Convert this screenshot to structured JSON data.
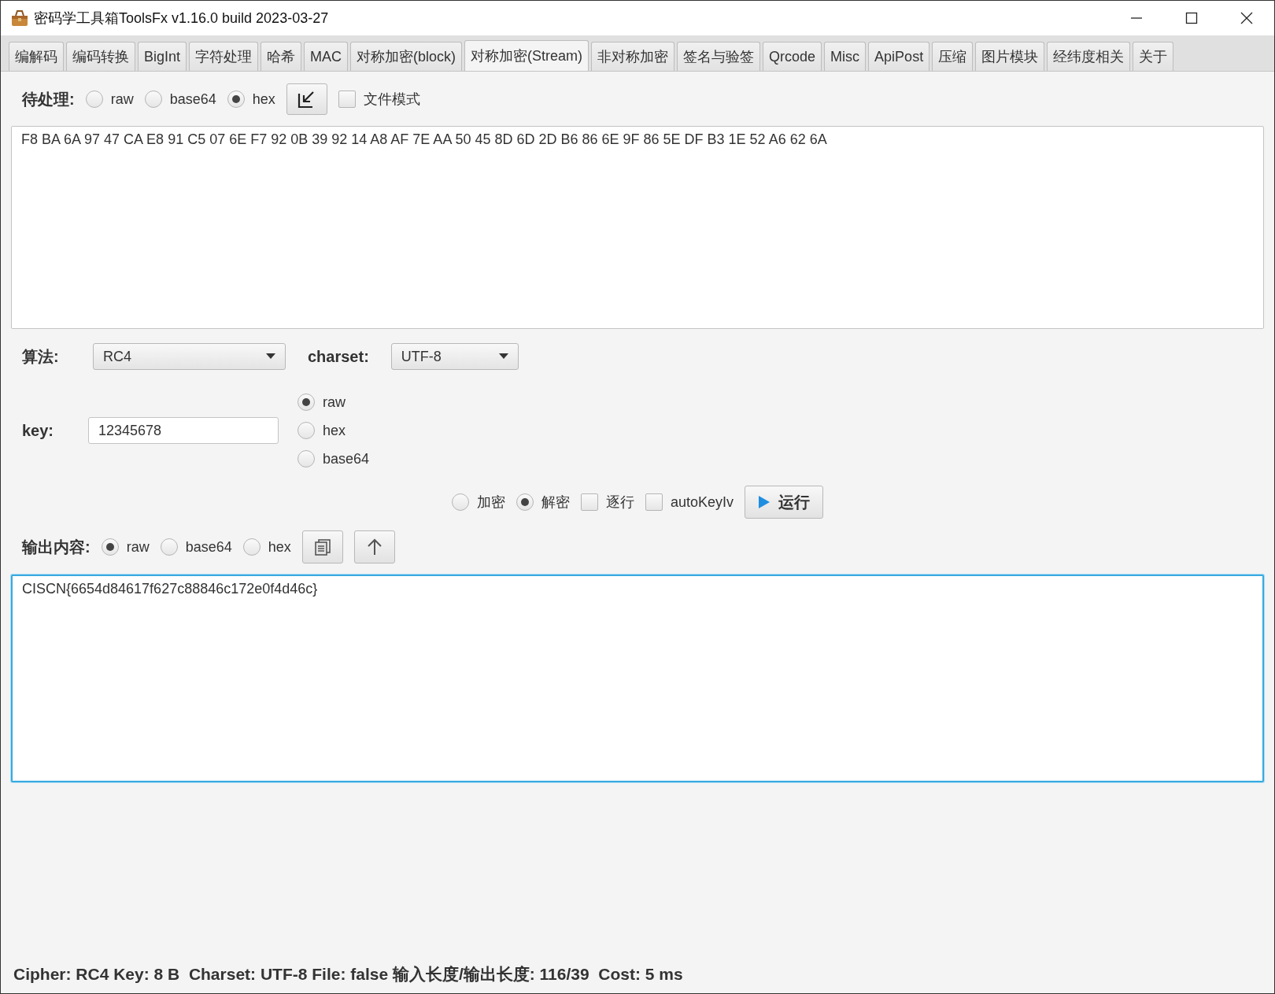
{
  "window": {
    "title": "密码学工具箱ToolsFx v1.16.0 build 2023-03-27"
  },
  "tabs": [
    {
      "label": "编解码",
      "selected": false
    },
    {
      "label": "编码转换",
      "selected": false
    },
    {
      "label": "BigInt",
      "selected": false
    },
    {
      "label": "字符处理",
      "selected": false
    },
    {
      "label": "哈希",
      "selected": false
    },
    {
      "label": "MAC",
      "selected": false
    },
    {
      "label": "对称加密(block)",
      "selected": false
    },
    {
      "label": "对称加密(Stream)",
      "selected": true
    },
    {
      "label": "非对称加密",
      "selected": false
    },
    {
      "label": "签名与验签",
      "selected": false
    },
    {
      "label": "Qrcode",
      "selected": false
    },
    {
      "label": "Misc",
      "selected": false
    },
    {
      "label": "ApiPost",
      "selected": false
    },
    {
      "label": "压缩",
      "selected": false
    },
    {
      "label": "图片模块",
      "selected": false
    },
    {
      "label": "经纬度相关",
      "selected": false
    },
    {
      "label": "关于",
      "selected": false
    }
  ],
  "input": {
    "label": "待处理:",
    "formats": [
      {
        "label": "raw",
        "selected": false
      },
      {
        "label": "base64",
        "selected": false
      },
      {
        "label": "hex",
        "selected": true
      }
    ],
    "file_mode": {
      "label": "文件模式",
      "checked": false
    },
    "value": "F8 BA 6A 97 47 CA E8 91 C5 07 6E F7 92 0B 39 92 14 A8 AF 7E AA 50 45 8D 6D 2D B6 86 6E 9F 86 5E DF B3 1E 52 A6 62 6A"
  },
  "algorithm": {
    "label": "算法:",
    "value": "RC4"
  },
  "charset": {
    "label": "charset:",
    "value": "UTF-8"
  },
  "key": {
    "label": "key:",
    "value": "12345678",
    "formats": [
      {
        "label": "raw",
        "selected": true
      },
      {
        "label": "hex",
        "selected": false
      },
      {
        "label": "base64",
        "selected": false
      }
    ]
  },
  "actions": {
    "modes": [
      {
        "label": "加密",
        "selected": false
      },
      {
        "label": "解密",
        "selected": true
      }
    ],
    "options": [
      {
        "label": "逐行",
        "checked": false
      },
      {
        "label": "autoKeyIv",
        "checked": false
      }
    ],
    "run_button": "运行"
  },
  "output": {
    "label": "输出内容:",
    "formats": [
      {
        "label": "raw",
        "selected": true
      },
      {
        "label": "base64",
        "selected": false
      },
      {
        "label": "hex",
        "selected": false
      }
    ],
    "value": "CISCN{6654d84617f627c88846c172e0f4d46c}",
    "focused": true
  },
  "status_bar": "Cipher: RC4 Key: 8 B  Charset: UTF-8 File: false 输入长度/输出长度: 116/39  Cost: 5 ms"
}
